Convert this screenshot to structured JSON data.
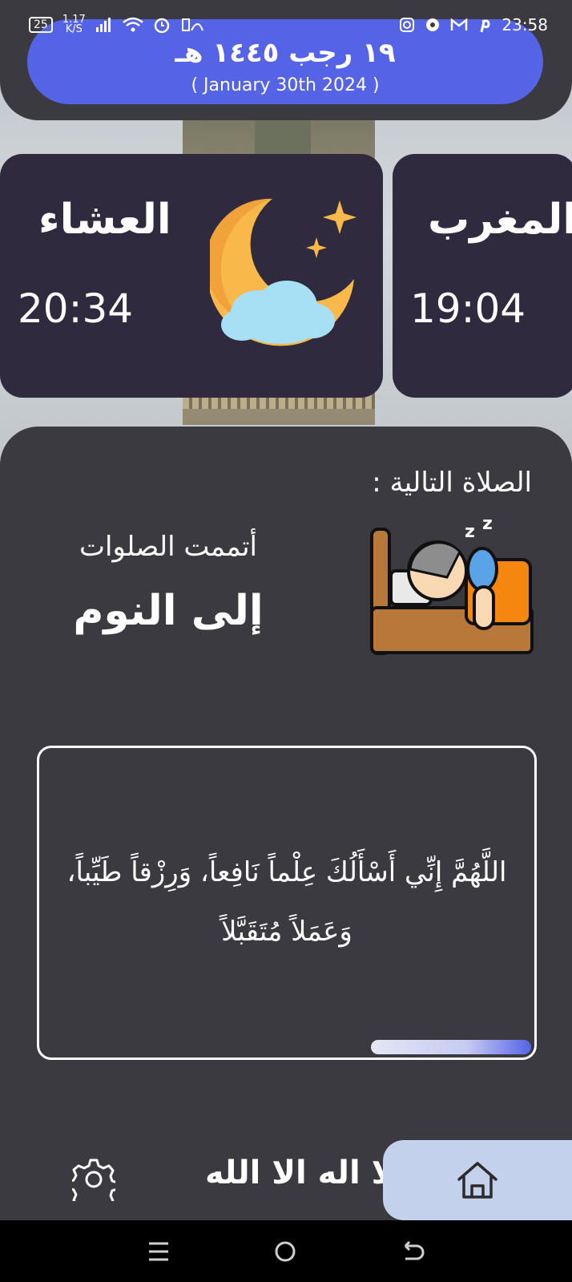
{
  "status_bar": {
    "battery": "25",
    "speed": "1.17",
    "speed_unit": "K/S",
    "time": "23:58"
  },
  "header": {
    "hijri_date": "١٩ رجب ١٤٤٥ هـ",
    "gregorian_date": "( January 30th 2024 )"
  },
  "prayers": {
    "isha": {
      "name": "العشاء",
      "time": "20:34"
    },
    "maghrib": {
      "name": "المغرب",
      "time": "19:04"
    }
  },
  "next_prayer": {
    "label": "الصلاة التالية :",
    "status": "أتممت الصلوات",
    "message": "إلى النوم"
  },
  "dua": {
    "text": "اللَّهُمَّ إِنِّي أَسْأَلُكَ عِلْماً نَافِعاً، وَرِزْقاً طَيِّباً، وَعَمَلاً مُتَقَبَّلاً"
  },
  "nav": {
    "tahlil_label": "لا اله الا الله",
    "items": [
      "home-icon",
      "settings-icon"
    ]
  },
  "colors": {
    "accent": "#5563e6",
    "panel": "#3b3a40",
    "card": "#2f2a3d",
    "home_bg": "#c4d1ec"
  }
}
